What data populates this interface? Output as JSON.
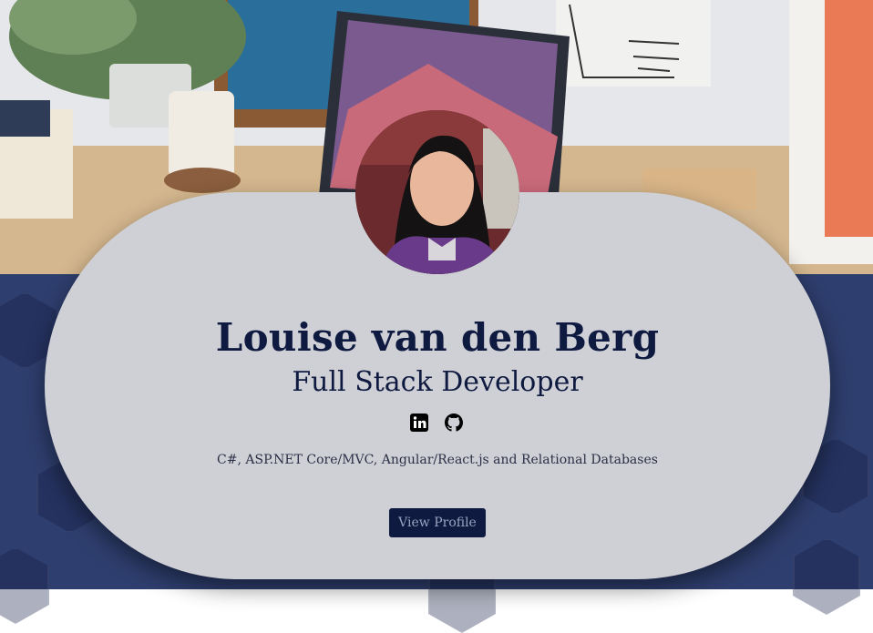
{
  "profile": {
    "name": "Louise van den Berg",
    "title": "Full Stack Developer",
    "skills": "C#, ASP.NET Core/MVC, Angular/React.js and Relational Databases",
    "button_label": "View Profile",
    "socials": [
      {
        "icon": "linkedin-icon"
      },
      {
        "icon": "github-icon"
      }
    ]
  },
  "colors": {
    "card_bg": "#cfd0d6",
    "navy": "#0f1a40",
    "page_bottom": "#2e3e6e"
  }
}
